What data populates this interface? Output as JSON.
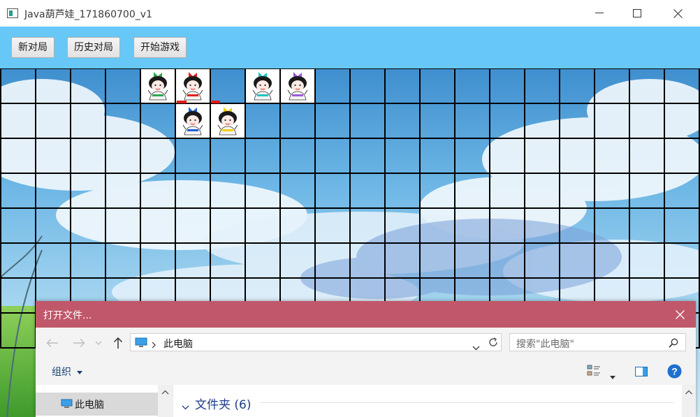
{
  "window": {
    "title": "Java葫芦娃_171860700_v1"
  },
  "toolbar": {
    "new_game": "新对局",
    "history": "历史对局",
    "start": "开始游戏"
  },
  "board": {
    "cols": 20,
    "rows": 8,
    "pieces": [
      {
        "col": 4,
        "row": 0,
        "hat": "#2fa84f",
        "marked": false
      },
      {
        "col": 5,
        "row": 0,
        "hat": "#e02020",
        "marked": true
      },
      {
        "col": 7,
        "row": 0,
        "hat": "#1fc4c0",
        "marked": false
      },
      {
        "col": 8,
        "row": 0,
        "hat": "#9a5ad8",
        "marked": false
      },
      {
        "col": 5,
        "row": 1,
        "hat": "#2060d0",
        "marked": false
      },
      {
        "col": 6,
        "row": 1,
        "hat": "#f0d010",
        "marked": false
      }
    ],
    "empty_marked_cells": [
      {
        "col": 6,
        "row": 0
      }
    ]
  },
  "dialog": {
    "title": "打开文件...",
    "address": "此电脑",
    "search_placeholder": "搜索\"此电脑\"",
    "organize": "组织",
    "nav_selected": "此电脑",
    "group_header": "文件夹 (6)",
    "title_color": "#c0576a"
  },
  "colors": {
    "toolbar": "#67c8f8",
    "grid_line": "#000000",
    "marker": "#e01818"
  }
}
